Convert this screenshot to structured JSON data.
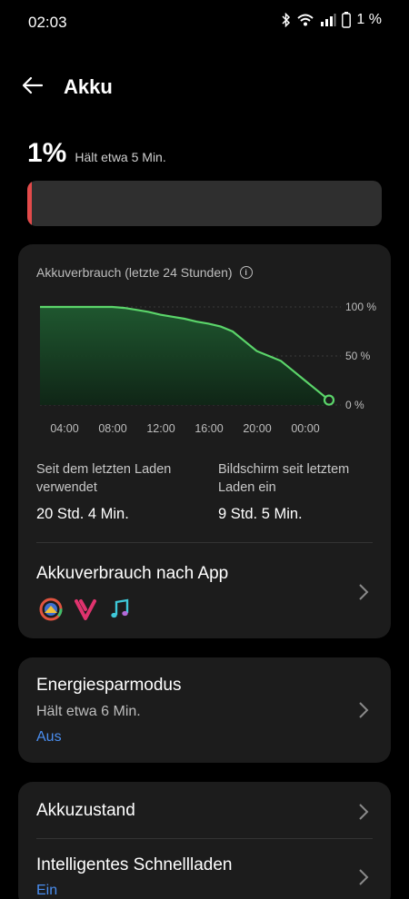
{
  "status_bar": {
    "time": "02:03",
    "battery_text": "1 %",
    "icons": [
      "bluetooth-icon",
      "wifi-icon",
      "signal-icon",
      "battery-icon"
    ]
  },
  "header": {
    "title": "Akku",
    "back_icon": "arrow-left-icon"
  },
  "battery": {
    "percent": "1%",
    "estimate": "Hält etwa 5 Min.",
    "level": 0.01,
    "level_color": "#e24a4a"
  },
  "usage_card": {
    "title": "Akkuverbrauch (letzte 24 Stunden)",
    "info_icon": "info-icon",
    "chart_data": {
      "type": "area",
      "title": "Akkuverbrauch (letzte 24 Stunden)",
      "x_tick_labels": [
        "04:00",
        "08:00",
        "12:00",
        "16:00",
        "20:00",
        "00:00"
      ],
      "y_tick_labels": [
        "100 %",
        "50 %",
        "0 %"
      ],
      "ylim": [
        0,
        100
      ],
      "x_hours": [
        0,
        2,
        4,
        6,
        7,
        8,
        9,
        10,
        11,
        12,
        13,
        14,
        15,
        16,
        17,
        18,
        19,
        20,
        21,
        22,
        23,
        24
      ],
      "values": [
        100,
        100,
        100,
        100,
        99,
        97,
        95,
        92,
        90,
        88,
        85,
        83,
        80,
        75,
        65,
        55,
        50,
        45,
        35,
        25,
        15,
        5
      ],
      "line_color": "#5bd56a",
      "fill_color": "#1f4a2a",
      "grid": "dotted"
    },
    "stats": [
      {
        "label": "Seit dem letzten Laden verwendet",
        "value": "20 Std. 4 Min."
      },
      {
        "label": "Bildschirm seit letztem Laden ein",
        "value": "9 Std. 5 Min."
      }
    ],
    "app_usage_title": "Akkuverbrauch nach App",
    "app_icons": [
      "app-icon-colorful-ring",
      "vivaldi-v-icon",
      "music-note-icon"
    ]
  },
  "saver_card": {
    "title": "Energiesparmodus",
    "subtitle": "Hält etwa 6 Min.",
    "state": "Aus"
  },
  "settings_card": {
    "item1_title": "Akkuzustand",
    "item2_title": "Intelligentes Schnellladen",
    "item2_state": "Ein"
  }
}
